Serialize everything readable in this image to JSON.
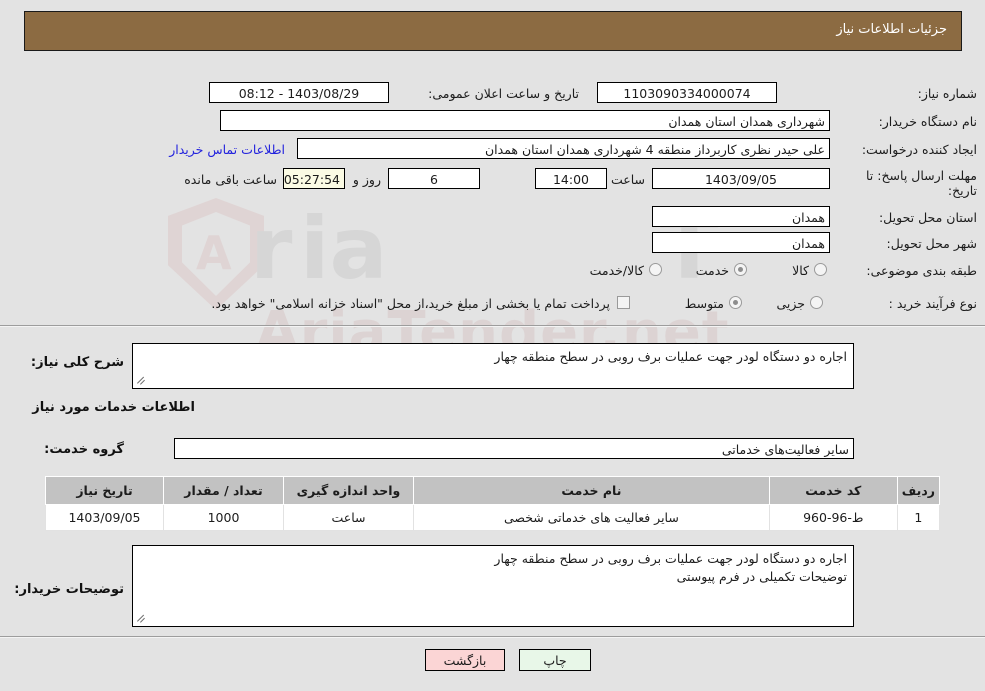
{
  "header": {
    "title": "جزئیات اطلاعات نیاز"
  },
  "info": {
    "need_number_label": "شماره نیاز:",
    "need_number_value": "1103090334000074",
    "announce_label": "تاریخ و ساعت اعلان عمومی:",
    "announce_value": "1403/08/29 - 08:12",
    "buyer_org_label": "نام دستگاه خریدار:",
    "buyer_org_value": "شهرداری همدان استان همدان",
    "creator_label": "ایجاد کننده درخواست:",
    "creator_value": "علی حیدر نظری کاربرداز منطقه 4 شهرداری همدان استان همدان",
    "contact_link": "اطلاعات تماس خریدار",
    "deadline_label": "مهلت ارسال پاسخ: تا تاریخ:",
    "deadline_date": "1403/09/05",
    "hour_label": "ساعت",
    "deadline_time": "14:00",
    "days_value": "6",
    "days_label": "روز و",
    "countdown_value": "05:27:54",
    "remaining_label": "ساعت باقی مانده",
    "province_label": "استان محل تحویل:",
    "province_value": "همدان",
    "city_label": "شهر محل تحویل:",
    "city_value": "همدان",
    "category_label": "طبقه بندی موضوعی:",
    "category_options": [
      "کالا",
      "خدمت",
      "کالا/خدمت"
    ],
    "category_selected": "خدمت",
    "process_label": "نوع فرآیند خرید :",
    "process_options": [
      "جزیی",
      "متوسط"
    ],
    "process_selected": "متوسط",
    "treasury_note": "پرداخت تمام یا بخشی از مبلغ خرید،از محل \"اسناد خزانه اسلامی\" خواهد بود."
  },
  "need_desc": {
    "label": "شرح کلی نیاز:",
    "value": "اجاره دو دستگاه لودر جهت عملیات برف روبی در سطح منطقه چهار"
  },
  "services_section": {
    "heading": "اطلاعات خدمات مورد نیاز",
    "group_label": "گروه خدمت:",
    "group_value": "سایر فعالیت‌های خدماتی"
  },
  "table": {
    "columns": [
      "ردیف",
      "کد خدمت",
      "نام خدمت",
      "واحد اندازه گیری",
      "تعداد / مقدار",
      "تاریخ نیاز"
    ],
    "rows": [
      {
        "row": "1",
        "service_code": "ط-96-960",
        "service_name": "سایر فعالیت های خدماتی شخصی",
        "unit": "ساعت",
        "quantity": "1000",
        "need_date": "1403/09/05"
      }
    ]
  },
  "buyer_notes": {
    "label": "توضیحات خریدار:",
    "line1": "اجاره دو دستگاه لودر جهت عملیات برف روبی در سطح منطقه چهار",
    "line2": "توضیحات تکمیلی در فرم پیوستی"
  },
  "buttons": {
    "back": "بازگشت",
    "print": "چاپ"
  },
  "watermark": {
    "text": "AriaTender.net"
  },
  "colors": {
    "header_bg": "#8c6b42",
    "link": "#2222dd",
    "highlight_field": "#fbfbe4",
    "table_header": "#c2c2c2",
    "back_button": "#fbd5d5",
    "print_button": "#e8f7e8"
  }
}
